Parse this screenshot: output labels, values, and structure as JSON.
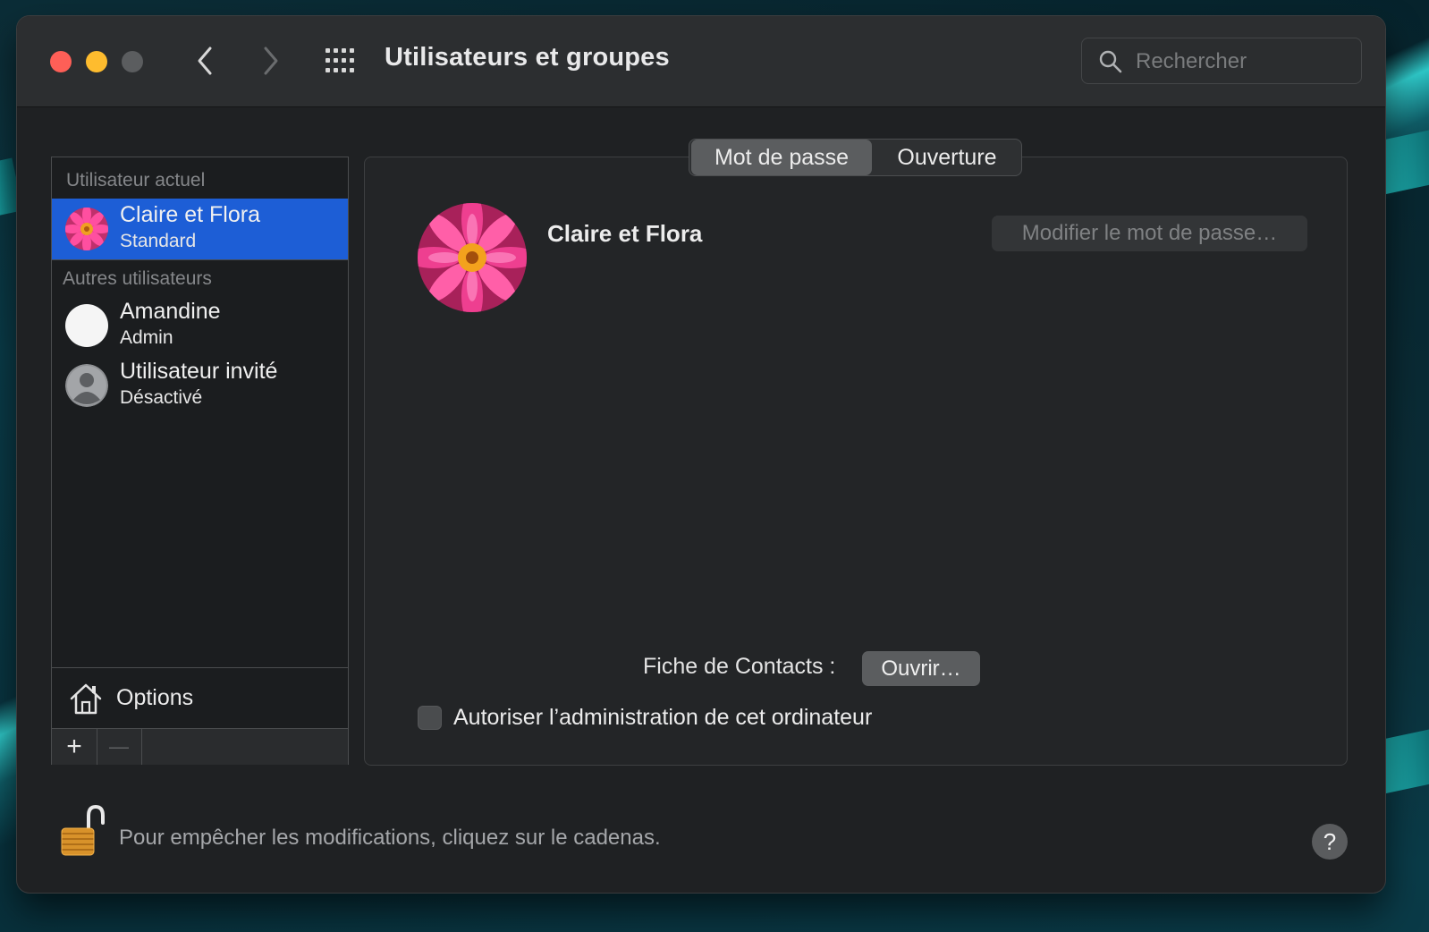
{
  "window": {
    "title": "Utilisateurs et groupes"
  },
  "search": {
    "placeholder": "Rechercher"
  },
  "sidebar": {
    "current_user_label": "Utilisateur actuel",
    "other_users_label": "Autres utilisateurs",
    "current_user": {
      "name": "Claire et Flora",
      "role": "Standard"
    },
    "other_users": [
      {
        "name": "Amandine",
        "role": "Admin"
      },
      {
        "name": "Utilisateur invité",
        "role": "Désactivé"
      }
    ],
    "options_label": "Options",
    "add_label": "+",
    "remove_label": "—"
  },
  "tabs": [
    {
      "label": "Mot de passe",
      "active": true
    },
    {
      "label": "Ouverture",
      "active": false
    }
  ],
  "detail": {
    "user_name": "Claire et Flora",
    "change_password_label": "Modifier le mot de passe…",
    "contacts_label": "Fiche de Contacts :",
    "open_label": "Ouvrir…",
    "allow_admin_label": "Autoriser l’administration de cet ordinateur",
    "allow_admin_checked": false
  },
  "footer": {
    "lock_text": "Pour empêcher les modifications, cliquez sur le cadenas.",
    "help_label": "?"
  },
  "colors": {
    "selection": "#1d5ed6",
    "close": "#fe5f57",
    "minimize": "#febc2e"
  }
}
